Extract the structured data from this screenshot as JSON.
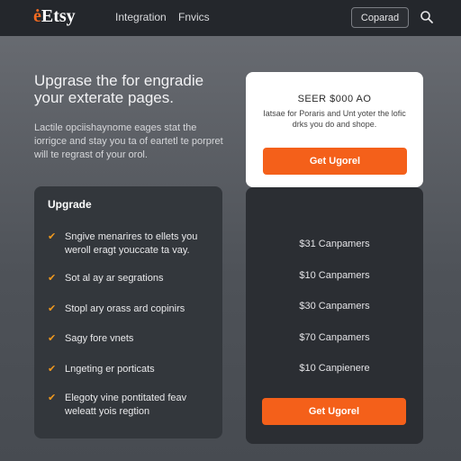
{
  "nav": {
    "logo_mark": "ė",
    "logo_text": "Etsy",
    "links": [
      "Integration",
      "Fnvics"
    ],
    "button_label": "Coparad",
    "search_icon": "search-icon"
  },
  "hero": {
    "title": "Upgrase the for engradie your exterate pages.",
    "description": "Lactile opciishaynome eages stat the iorrigce and stay you ta of eartetl te porpret will te regrast of your orol."
  },
  "features_card": {
    "title": "Upgrade",
    "items": [
      "Sngive menarires to ellets you weroll eragt youccate ta vay.",
      "Sot al ay ar segrations",
      "Stopl ary orass ard copinirs",
      "Sagy fore vnets",
      "Lngeting er porticats",
      "Elegoty vine pontitated feav weleatt yois regtion"
    ]
  },
  "promo": {
    "title": "SEER $000 AO",
    "description": "Iatsae for Poraris and Unt yoter the lofic drks you do and shope.",
    "button_label": "Get Ugorel"
  },
  "pricing": {
    "rows": [
      "$31 Canpamers",
      "$10 Canpamers",
      "$30 Canpamers",
      "$70 Canpamers",
      "$10 Canpienere"
    ],
    "button_label": "Get Ugorel"
  },
  "colors": {
    "accent": "#f4601a",
    "nav_bg": "#24272c",
    "check": "#f39a1e"
  }
}
